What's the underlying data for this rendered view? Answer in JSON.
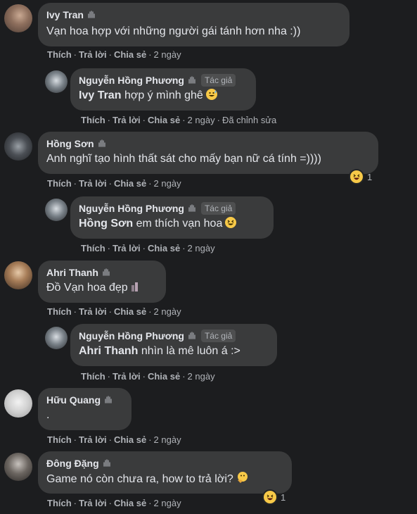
{
  "comments": [
    {
      "author": "Ivy Tran",
      "text": "Vạn hoa hợp với những người gái tánh hơn nha :))",
      "time": "2 ngày"
    },
    {
      "author": "Nguyễn Hồng Phương",
      "badge": "Tác giả",
      "mention": "Ivy Tran",
      "text": "hợp ý mình ghê",
      "time": "2 ngày",
      "edited": "Đã chỉnh sửa"
    },
    {
      "author": "Hồng Sơn",
      "text": "Anh nghĩ tạo hình thất sát cho mấy bạn nữ cá tính =))))",
      "time": "2 ngày",
      "reaction_count": "1"
    },
    {
      "author": "Nguyễn Hồng Phương",
      "badge": "Tác giả",
      "mention": "Hồng Sơn",
      "text": "em thích vạn hoa",
      "time": "2 ngày"
    },
    {
      "author": "Ahri Thanh",
      "text": "Đồ Vạn hoa đẹp",
      "time": "2 ngày"
    },
    {
      "author": "Nguyễn Hồng Phương",
      "badge": "Tác giả",
      "mention": "Ahri Thanh",
      "text": "nhìn là mê luôn á :>",
      "time": "2 ngày"
    },
    {
      "author": "Hữu Quang",
      "text": ".",
      "time": "2 ngày"
    },
    {
      "author": "Đông Đặng",
      "text": "Game nó còn chưa ra, how to trả lời?",
      "time": "2 ngày",
      "reaction_count": "1"
    }
  ],
  "actions": {
    "like": "Thích",
    "reply": "Trả lời",
    "share": "Chia sẻ",
    "dot": "·"
  },
  "colors": {
    "background": "#1c1d1f",
    "bubble": "#3a3b3c",
    "muted": "#b0b3b8",
    "text": "#e4e6eb"
  },
  "icons": {
    "wave": "wave-hand-icon",
    "haha": "haha-reaction-icon"
  }
}
